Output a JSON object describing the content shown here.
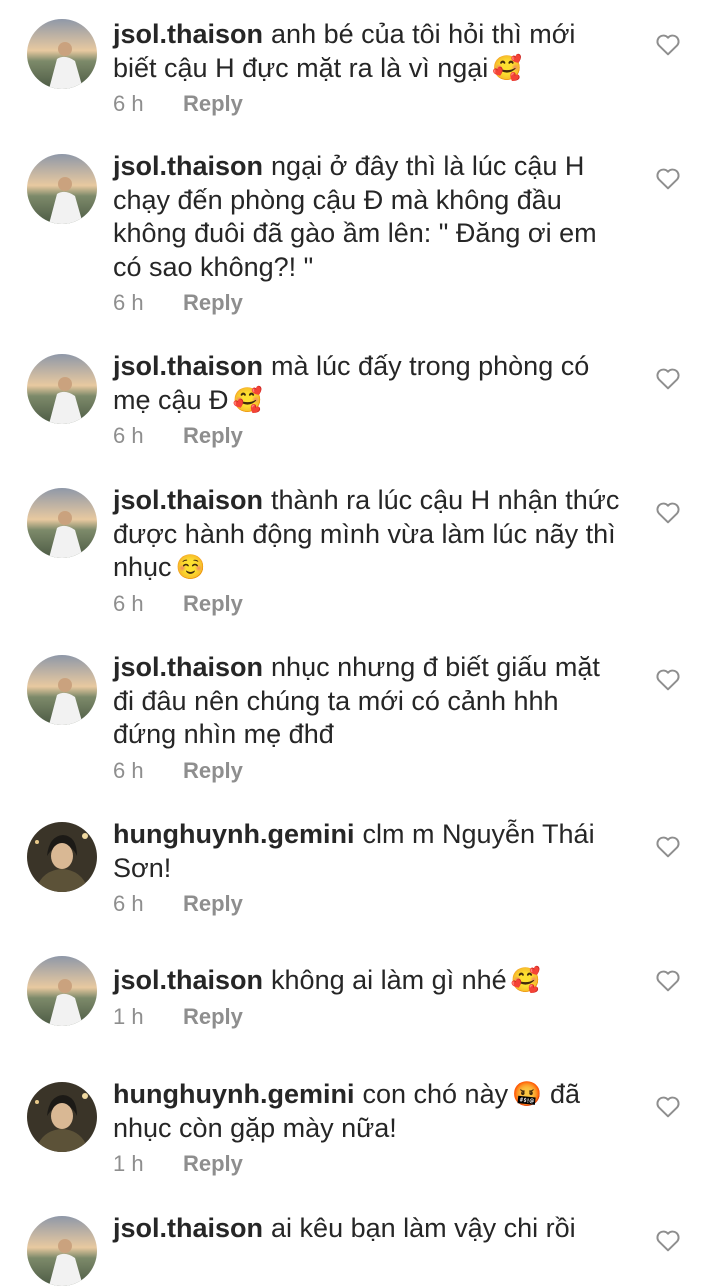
{
  "comments": [
    {
      "username": "jsol.thaison",
      "text": "anh bé của tôi hỏi thì mới biết cậu H đực mặt ra là vì ngại",
      "emoji": "🥰",
      "emoji_icon": "smiling-face-with-hearts-icon",
      "time": "6 h",
      "reply_label": "Reply",
      "avatar": "sunset-avatar"
    },
    {
      "username": "jsol.thaison",
      "text": "ngại ở đây thì là lúc cậu H chạy đến phòng cậu Đ mà không đầu không đuôi đã gào ầm lên: \" Đăng ơi em có sao không?! \"",
      "emoji": "",
      "time": "6 h",
      "reply_label": "Reply",
      "avatar": "sunset-avatar"
    },
    {
      "username": "jsol.thaison",
      "text": "mà lúc đấy trong phòng có mẹ cậu Đ",
      "emoji": "🥰",
      "emoji_icon": "smiling-face-with-hearts-icon",
      "time": "6 h",
      "reply_label": "Reply",
      "avatar": "sunset-avatar"
    },
    {
      "username": "jsol.thaison",
      "text": "thành ra lúc cậu H nhận thức được hành động mình vừa làm lúc nãy thì nhục",
      "emoji": "☺️",
      "emoji_icon": "smiling-face-icon",
      "time": "6 h",
      "reply_label": "Reply",
      "avatar": "sunset-avatar"
    },
    {
      "username": "jsol.thaison",
      "text": "nhục nhưng đ biết giấu mặt đi đâu nên chúng ta mới có cảnh hhh đứng nhìn mẹ đhđ",
      "emoji": "",
      "time": "6 h",
      "reply_label": "Reply",
      "avatar": "sunset-avatar"
    },
    {
      "username": "hunghuynh.gemini",
      "text": "clm m Nguyễn Thái Sơn!",
      "emoji": "",
      "time": "6 h",
      "reply_label": "Reply",
      "avatar": "portrait-avatar"
    },
    {
      "username": "jsol.thaison",
      "text": "không ai làm gì nhé",
      "emoji": "🥰",
      "emoji_icon": "smiling-face-with-hearts-icon",
      "time": "1 h",
      "reply_label": "Reply",
      "avatar": "sunset-avatar"
    },
    {
      "username": "hunghuynh.gemini",
      "text": "con chó này",
      "emoji": "🤬",
      "emoji_icon": "face-with-symbols-on-mouth-icon",
      "text_after": "đã nhục còn gặp mày nữa!",
      "time": "1 h",
      "reply_label": "Reply",
      "avatar": "portrait-avatar"
    },
    {
      "username": "jsol.thaison",
      "text": "ai kêu bạn làm vậy chi rồi",
      "emoji": "",
      "time": "",
      "reply_label": "",
      "avatar": "sunset-avatar"
    }
  ],
  "colors": {
    "text": "#262626",
    "meta": "#8e8e8e",
    "background": "#ffffff"
  }
}
